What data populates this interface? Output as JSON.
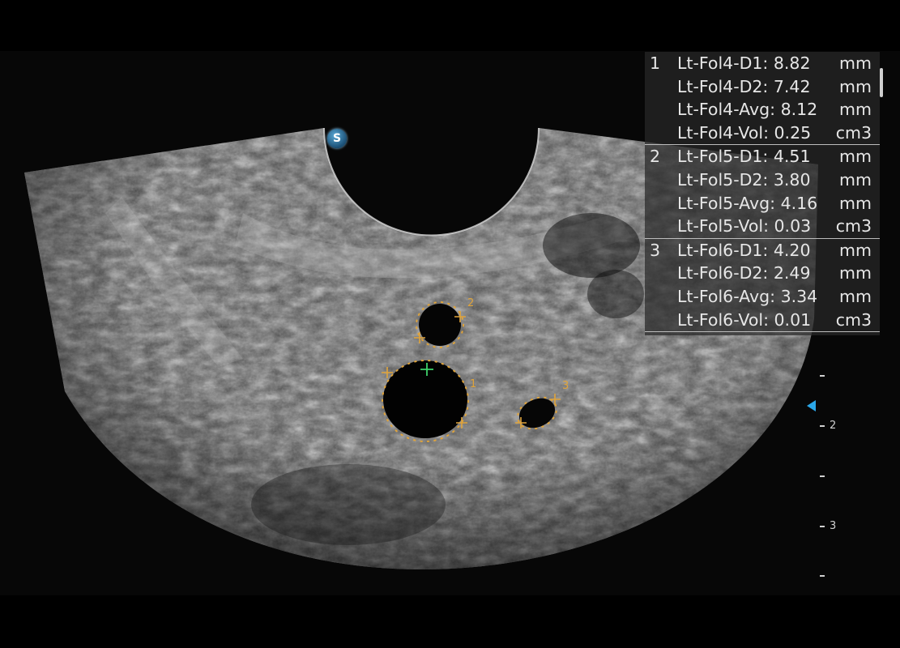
{
  "measurement_panel": {
    "groups": [
      {
        "number": "1",
        "rows": [
          {
            "label": "Lt-Fol4-D1:",
            "value": "8.82",
            "unit": "mm"
          },
          {
            "label": "Lt-Fol4-D2:",
            "value": "7.42",
            "unit": "mm"
          },
          {
            "label": "Lt-Fol4-Avg:",
            "value": "8.12",
            "unit": "mm"
          },
          {
            "label": "Lt-Fol4-Vol:",
            "value": "0.25",
            "unit": "cm3"
          }
        ]
      },
      {
        "number": "2",
        "rows": [
          {
            "label": "Lt-Fol5-D1:",
            "value": "4.51",
            "unit": "mm"
          },
          {
            "label": "Lt-Fol5-D2:",
            "value": "3.80",
            "unit": "mm"
          },
          {
            "label": "Lt-Fol5-Avg:",
            "value": "4.16",
            "unit": "mm"
          },
          {
            "label": "Lt-Fol5-Vol:",
            "value": "0.03",
            "unit": "cm3"
          }
        ]
      },
      {
        "number": "3",
        "rows": [
          {
            "label": "Lt-Fol6-D1:",
            "value": "4.20",
            "unit": "mm"
          },
          {
            "label": "Lt-Fol6-D2:",
            "value": "2.49",
            "unit": "mm"
          },
          {
            "label": "Lt-Fol6-Avg:",
            "value": "3.34",
            "unit": "mm"
          },
          {
            "label": "Lt-Fol6-Vol:",
            "value": "0.01",
            "unit": "cm3"
          }
        ]
      }
    ]
  },
  "depth_scale": {
    "labels": [
      "2",
      "3"
    ]
  },
  "follicle_labels": [
    "1",
    "2",
    "3"
  ],
  "badge": {
    "text": "S"
  },
  "colors": {
    "caliper": "#e0a43b",
    "active_caliper": "#3fd26a",
    "focus_marker": "#2aa6e8"
  }
}
